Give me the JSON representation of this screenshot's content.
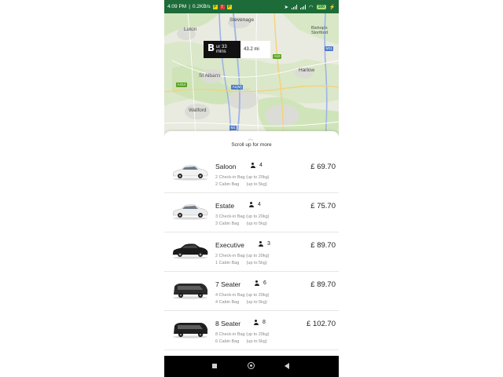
{
  "status_bar": {
    "time": "4:09 PM",
    "speed": "0.2KB/s",
    "battery": "100",
    "app_icons": [
      "P",
      "!",
      "P"
    ]
  },
  "map": {
    "places": {
      "stevenage": "Stevenage",
      "luton": "Luton",
      "bishops_stortford": "Bishop's\nStortford",
      "harlow": "Harlow",
      "st_albans": "St Albans",
      "watford": "Watford"
    },
    "roads": {
      "m11_top": "M11",
      "a10": "A10",
      "a414": "A414",
      "a1m": "A1(M)",
      "m1": "M1"
    },
    "trip": {
      "marker": "B",
      "duration": "1 hour 33 mins",
      "duration_visible": "ur 33 mins",
      "distance": "43.2 mi"
    }
  },
  "sheet": {
    "scroll_hint": "Scroll up for more"
  },
  "vehicles": [
    {
      "name": "Saloon",
      "passengers": "4",
      "price": "£ 69.70",
      "checkin": "2 Check-in Bag (up to 20kg)",
      "cabin": "2 Cabin Bag      (up to 5kg)",
      "color": "#f2f2f2"
    },
    {
      "name": "Estate",
      "passengers": "4",
      "price": "£ 75.70",
      "checkin": "3 Check-in Bag (up to 20kg)",
      "cabin": "3 Cabin Bag      (up to 5kg)",
      "color": "#ececec"
    },
    {
      "name": "Executive",
      "passengers": "3",
      "price": "£ 89.70",
      "checkin": "2 Check-in Bag (up to 20kg)",
      "cabin": "1 Cabin Bag      (up to 5kg)",
      "color": "#1a1a1a"
    },
    {
      "name": "7 Seater",
      "passengers": "6",
      "price": "£ 89.70",
      "checkin": "4 Check-in Bag (up to 20kg)",
      "cabin": "4 Cabin Bag      (up to 5kg)",
      "color": "#2a2a2a"
    },
    {
      "name": "8 Seater",
      "passengers": "8",
      "price": "£ 102.70",
      "checkin": "8 Check-in Bag (up to 20kg)",
      "cabin": "6 Cabin Bag      (up to 5kg)",
      "color": "#1f1f1f"
    }
  ],
  "colors": {
    "status_bar": "#1e6b3a",
    "map_bg": "#e8eadd",
    "park_green": "#cfe3b8",
    "urban": "#dcdcd6"
  }
}
